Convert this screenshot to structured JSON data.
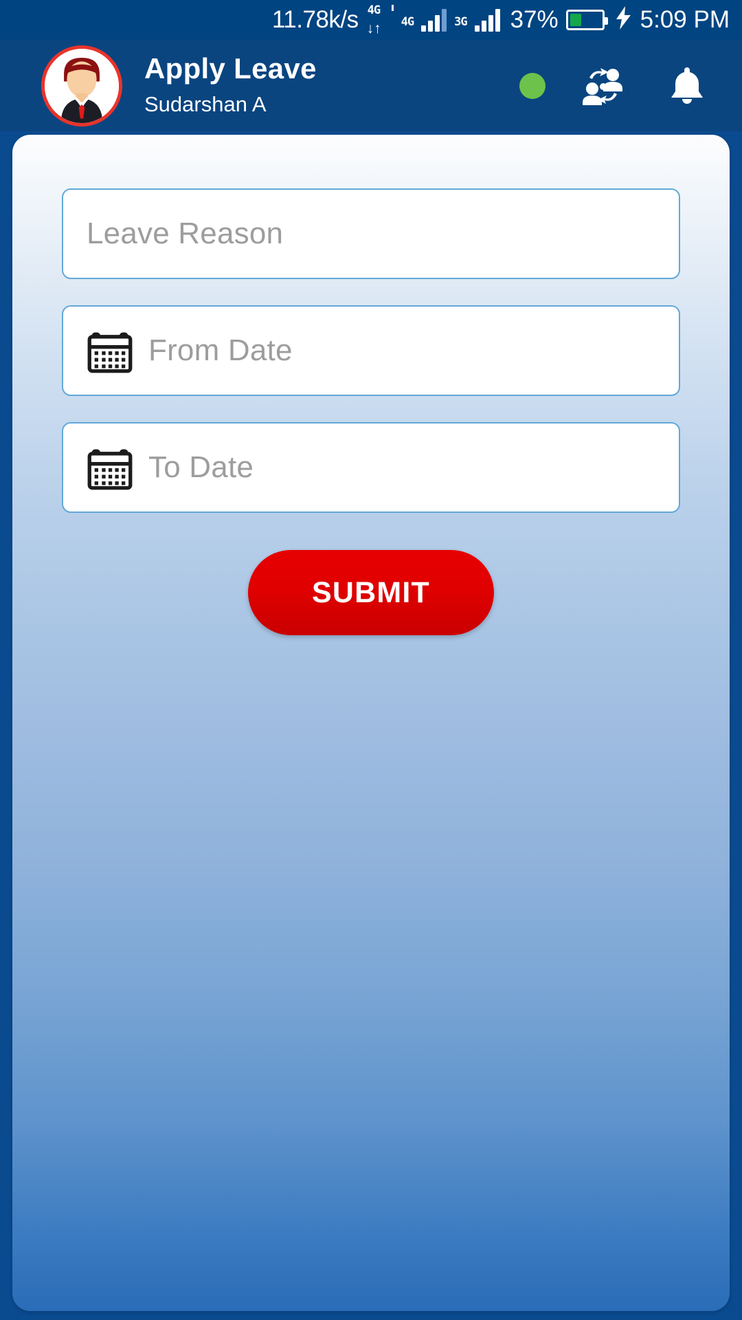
{
  "status_bar": {
    "network_speed": "11.78k/s",
    "data_icon_label": "4G",
    "data_transfer_arrows": "↓↑",
    "network_tag_1": "4G",
    "network_tag_2": "3G",
    "battery_percent_label": "37%",
    "battery_level": 37,
    "charging_bolt": "⚡",
    "clock": "5:09 PM",
    "background_color": "#004481",
    "battery_fill_color": "#14a84b"
  },
  "header": {
    "title": "Apply Leave",
    "subtitle": "Sudarshan A",
    "background_color": "#0a4580",
    "avatar_ring_color": "#e8342c",
    "status_dot_color": "#6cc24a",
    "icons": {
      "status_dot": "online-status-dot",
      "switch_user": "switch-user-icon",
      "notifications": "bell-icon"
    }
  },
  "form": {
    "fields": [
      {
        "name": "leave-reason",
        "placeholder": "Leave Reason",
        "value": "",
        "has_calendar_icon": false
      },
      {
        "name": "from-date",
        "placeholder": "From Date",
        "value": "",
        "has_calendar_icon": true
      },
      {
        "name": "to-date",
        "placeholder": "To Date",
        "value": "",
        "has_calendar_icon": true
      }
    ],
    "submit_label": "SUBMIT",
    "submit_color": "#e00000",
    "field_border_color": "#62a8d8",
    "placeholder_color": "#9d9d9d"
  },
  "card": {
    "gradient_top": "#fdfdfe",
    "gradient_bottom": "#2a6cb7"
  }
}
